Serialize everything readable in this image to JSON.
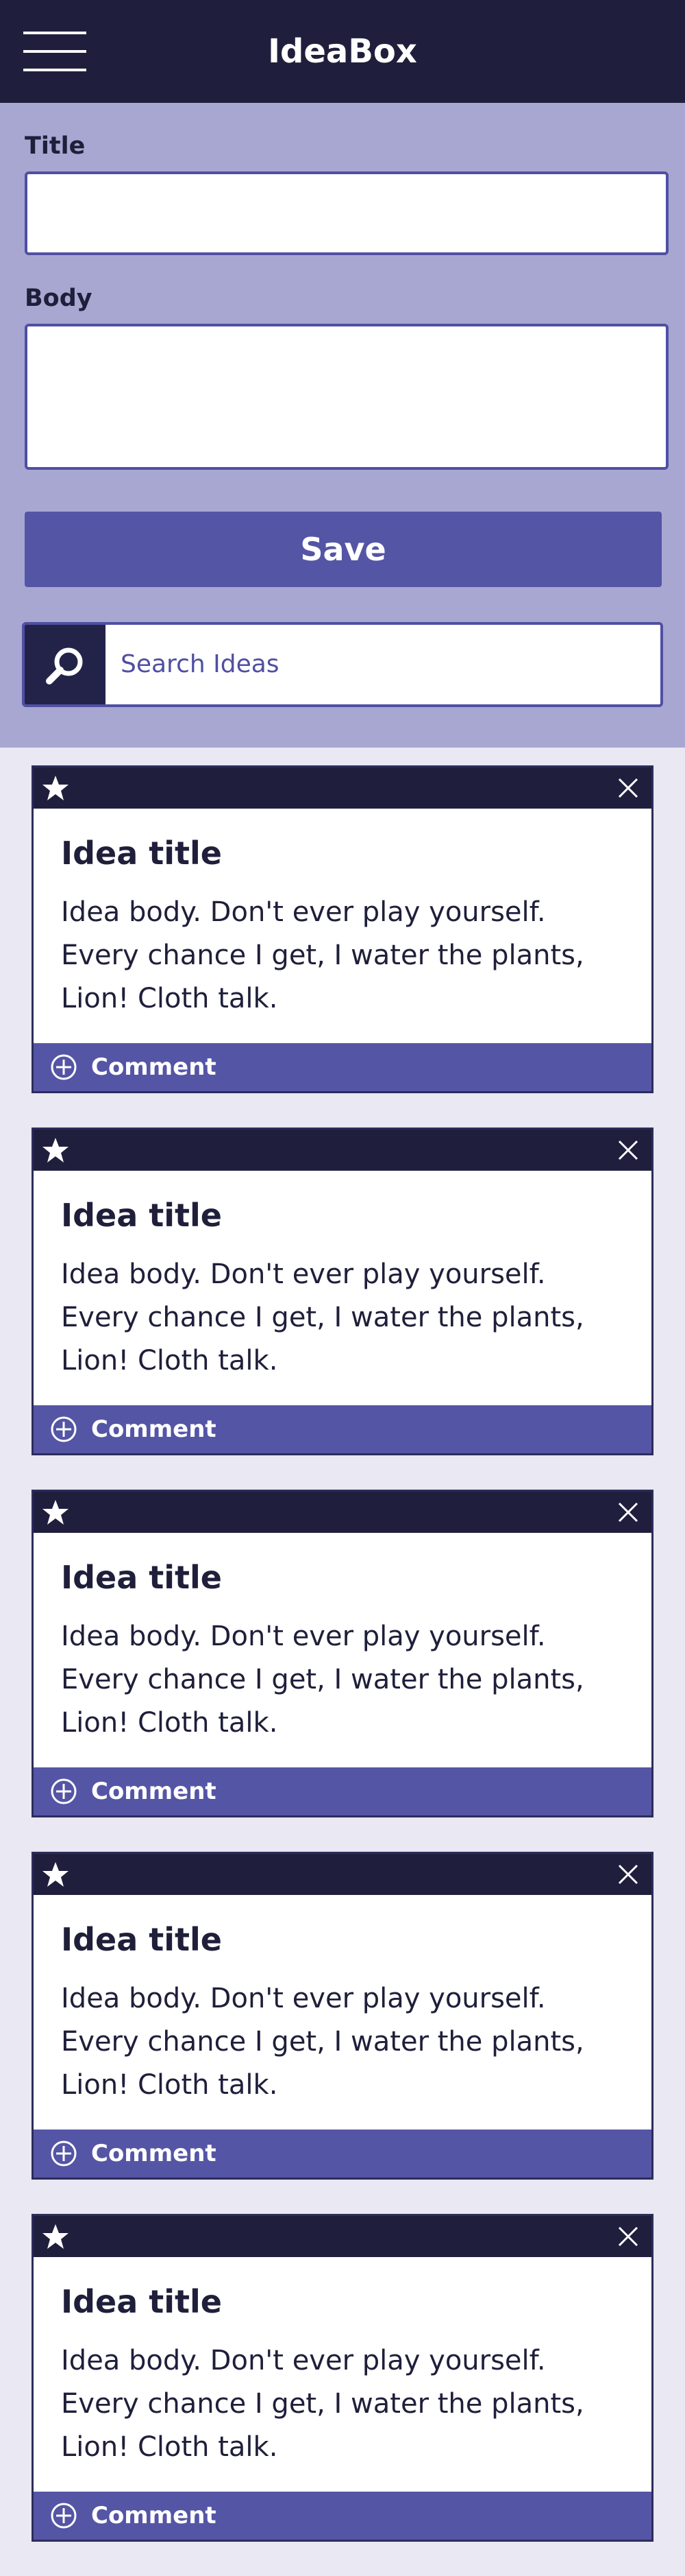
{
  "header": {
    "app_title": "IdeaBox"
  },
  "form": {
    "title_label": "Title",
    "title_value": "",
    "body_label": "Body",
    "body_value": "",
    "save_label": "Save"
  },
  "search": {
    "placeholder": "Search Ideas",
    "value": ""
  },
  "cards": [
    {
      "title": "Idea title",
      "body": "Idea body. Don't ever play yourself. Every chance I get, I water the plants, Lion! Cloth talk.",
      "comment_label": "Comment"
    },
    {
      "title": "Idea title",
      "body": "Idea body. Don't ever play yourself. Every chance I get, I water the plants, Lion! Cloth talk.",
      "comment_label": "Comment"
    },
    {
      "title": "Idea title",
      "body": "Idea body. Don't ever play yourself. Every chance I get, I water the plants, Lion! Cloth talk.",
      "comment_label": "Comment"
    },
    {
      "title": "Idea title",
      "body": "Idea body. Don't ever play yourself. Every chance I get, I water the plants, Lion! Cloth talk.",
      "comment_label": "Comment"
    },
    {
      "title": "Idea title",
      "body": "Idea body. Don't ever play yourself. Every chance I get, I water the plants, Lion! Cloth talk.",
      "comment_label": "Comment"
    }
  ],
  "icons": {
    "menu": "hamburger-menu-icon",
    "search": "search-icon",
    "favorite": "star-icon",
    "delete": "close-icon",
    "comment": "plus-circle-icon"
  },
  "colors": {
    "header": "#1f1f3d",
    "form_background": "#a7a7d1",
    "accent": "#5555a6",
    "page_background": "#e9e8f3"
  }
}
